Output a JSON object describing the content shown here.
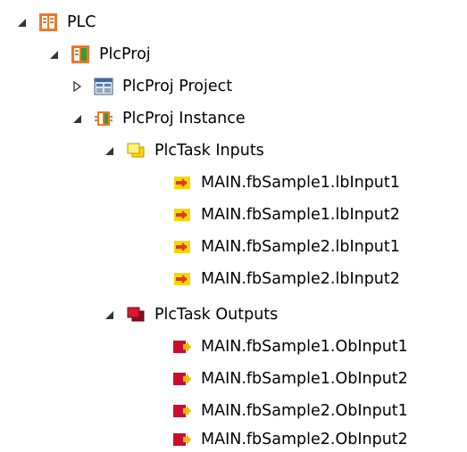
{
  "tree": {
    "plc": {
      "label": "PLC",
      "icon": "plc-icon",
      "expanded": true
    },
    "plcproj": {
      "label": "PlcProj",
      "icon": "plc-project-icon",
      "expanded": true
    },
    "plcproj_project": {
      "label": "PlcProj Project",
      "icon": "project-window-icon",
      "expanded": false
    },
    "plcproj_instance": {
      "label": "PlcProj Instance",
      "icon": "plc-instance-icon",
      "expanded": true
    },
    "inputs": {
      "label": "PlcTask Inputs",
      "icon": "input-folder-icon",
      "expanded": true,
      "items": [
        "MAIN.fbSample1.lbInput1",
        "MAIN.fbSample1.lbInput2",
        "MAIN.fbSample2.lbInput1",
        "MAIN.fbSample2.lbInput2"
      ]
    },
    "outputs": {
      "label": "PlcTask Outputs",
      "icon": "output-folder-icon",
      "expanded": true,
      "items": [
        "MAIN.fbSample1.ObInput1",
        "MAIN.fbSample1.ObInput2",
        "MAIN.fbSample2.ObInput1",
        "MAIN.fbSample2.ObInput2"
      ]
    }
  },
  "colors": {
    "plc_orange": "#e8792b",
    "plc_green": "#2e9e3c",
    "input_yellow": "#f5d800",
    "input_arrow": "#e23a1e",
    "output_red": "#c8102e",
    "toggle": "#333333"
  }
}
